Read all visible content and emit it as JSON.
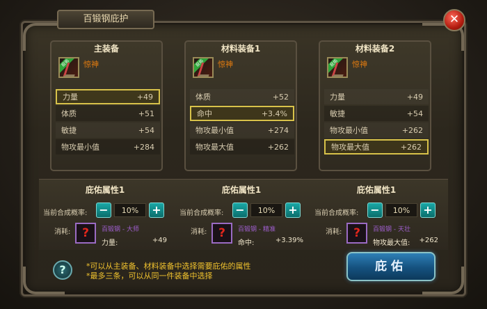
{
  "window": {
    "title": "百锻钢庇护",
    "close_symbol": "✕"
  },
  "panels": [
    {
      "title": "主装备",
      "item_badge": "庇佑",
      "item_name": "惊神",
      "stats": [
        {
          "label": "力量",
          "value": "+49",
          "selected": true
        },
        {
          "label": "体质",
          "value": "+51",
          "selected": false
        },
        {
          "label": "敏捷",
          "value": "+54",
          "selected": false
        },
        {
          "label": "物攻最小值",
          "value": "+284",
          "selected": false
        }
      ]
    },
    {
      "title": "材料装备1",
      "item_badge": "庇佑",
      "item_name": "惊神",
      "stats": [
        {
          "label": "体质",
          "value": "+52",
          "selected": false
        },
        {
          "label": "命中",
          "value": "+3.4%",
          "selected": true
        },
        {
          "label": "物攻最小值",
          "value": "+274",
          "selected": false
        },
        {
          "label": "物攻最大值",
          "value": "+262",
          "selected": false
        }
      ]
    },
    {
      "title": "材料装备2",
      "item_badge": "庇佑",
      "item_name": "惊神",
      "stats": [
        {
          "label": "力量",
          "value": "+49",
          "selected": false
        },
        {
          "label": "敏捷",
          "value": "+54",
          "selected": false
        },
        {
          "label": "物攻最小值",
          "value": "+262",
          "selected": false
        },
        {
          "label": "物攻最大值",
          "value": "+262",
          "selected": true
        }
      ]
    }
  ],
  "blessings": [
    {
      "title": "庇佑属性1",
      "rate_label": "当前合成概率:",
      "rate": "10%",
      "minus": "−",
      "plus": "+",
      "cost_label": "消耗:",
      "cost_icon": "?",
      "material": "百锻钢 - 大师",
      "bonus_name": "力量:",
      "bonus_value": "+49"
    },
    {
      "title": "庇佑属性1",
      "rate_label": "当前合成概率:",
      "rate": "10%",
      "minus": "−",
      "plus": "+",
      "cost_label": "消耗:",
      "cost_icon": "?",
      "material": "百锻钢 - 精准",
      "bonus_name": "命中:",
      "bonus_value": "+3.39%"
    },
    {
      "title": "庇佑属性1",
      "rate_label": "当前合成概率:",
      "rate": "10%",
      "minus": "−",
      "plus": "+",
      "cost_label": "消耗:",
      "cost_icon": "?",
      "material": "百锻钢 - 天壮",
      "bonus_name": "物攻最大值:",
      "bonus_value": "+262"
    }
  ],
  "tips": [
    "*可以从主装备、材料装备中选择需要庇佑的属性",
    "*最多三条，可以从同一件装备中选择"
  ],
  "help_symbol": "?",
  "bless_button": "庇佑",
  "colors": {
    "highlight": "#d8c24a",
    "item_name": "#e07a10",
    "tip": "#f0c22e",
    "material": "#a05fd0"
  }
}
